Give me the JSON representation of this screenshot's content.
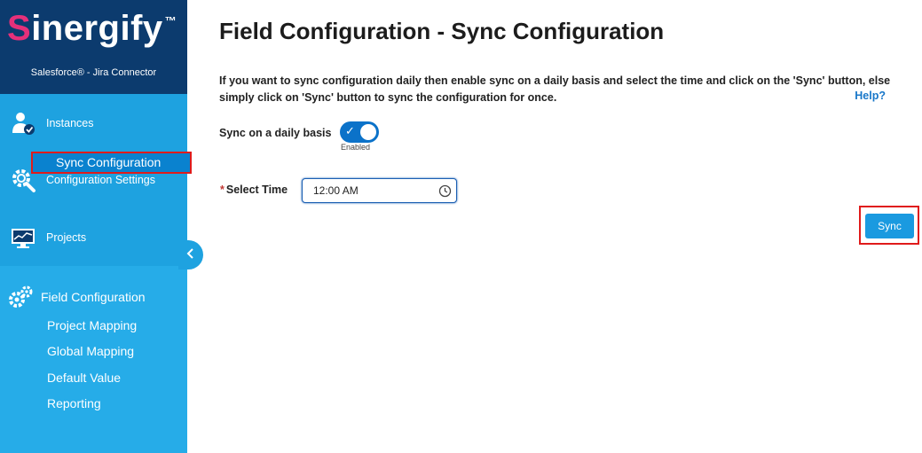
{
  "brand": {
    "logo_first": "S",
    "logo_rest": "inergify",
    "trademark": "™",
    "subtitle": "Salesforce® - Jira Connector"
  },
  "sidebar": {
    "items": [
      {
        "label": "Instances",
        "icon": "user-check-icon"
      },
      {
        "label": "Configuration Settings",
        "icon": "gear-search-icon"
      },
      {
        "label": "Projects",
        "icon": "monitor-chart-icon"
      }
    ],
    "field_configuration": {
      "label": "Field Configuration",
      "icon": "gears-icon",
      "subitems": [
        {
          "label": "Project Mapping"
        },
        {
          "label": "Global Mapping"
        },
        {
          "label": "Default Value"
        },
        {
          "label": "Reporting"
        },
        {
          "label": "Sync Configuration",
          "active": true
        }
      ]
    },
    "collapse_icon": "chevron-left-icon"
  },
  "main": {
    "title": "Field Configuration - Sync Configuration",
    "description": "If you want to sync configuration daily then enable sync on a daily basis and select the time and click on the 'Sync' button, else simply click on 'Sync' button to sync the configuration for once.",
    "help_link": "Help?",
    "daily_label": "Sync on a daily basis",
    "toggle_state": "Enabled",
    "toggle_on": true,
    "time_required_mark": "*",
    "time_label": "Select Time",
    "time_value": "12:00 AM",
    "sync_button": "Sync"
  },
  "colors": {
    "sidebar": "#1ea2e0",
    "brand_bg": "#0c3b6e",
    "active_item": "#0a82cf",
    "highlight_border": "#e01b1b",
    "button": "#1a9ae0",
    "link": "#1877c9"
  }
}
